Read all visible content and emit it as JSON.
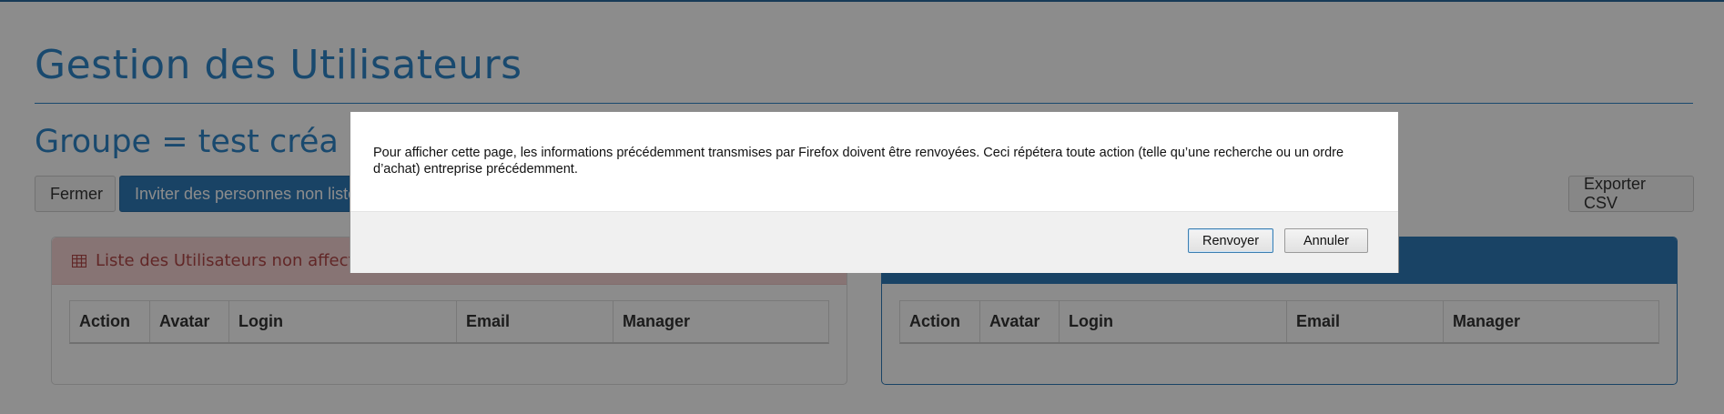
{
  "page": {
    "title": "Gestion des Utilisateurs",
    "group_title": "Groupe = test créa"
  },
  "toolbar": {
    "close_label": "Fermer",
    "invite_label": "Inviter des personnes non listées",
    "export_label": "Exporter CSV"
  },
  "panels": {
    "left": {
      "title": "Liste des Utilisateurs non affectés",
      "icon": "table-icon"
    },
    "right": {
      "title": ""
    },
    "columns": [
      "Action",
      "Avatar",
      "Login",
      "Email",
      "Manager"
    ]
  },
  "dialog": {
    "message": "Pour afficher cette page, les informations précédemment transmises par Firefox doivent être renvoyées. Ceci répétera toute action (telle qu’une recherche ou un ordre d’achat) entreprise précédemment.",
    "resend_label": "Renvoyer",
    "cancel_label": "Annuler"
  },
  "colors": {
    "accent": "#2e86c8",
    "primary_button": "#2f7ab8",
    "danger_panel_header": "#f6d3d3",
    "danger_text": "#b14848"
  }
}
